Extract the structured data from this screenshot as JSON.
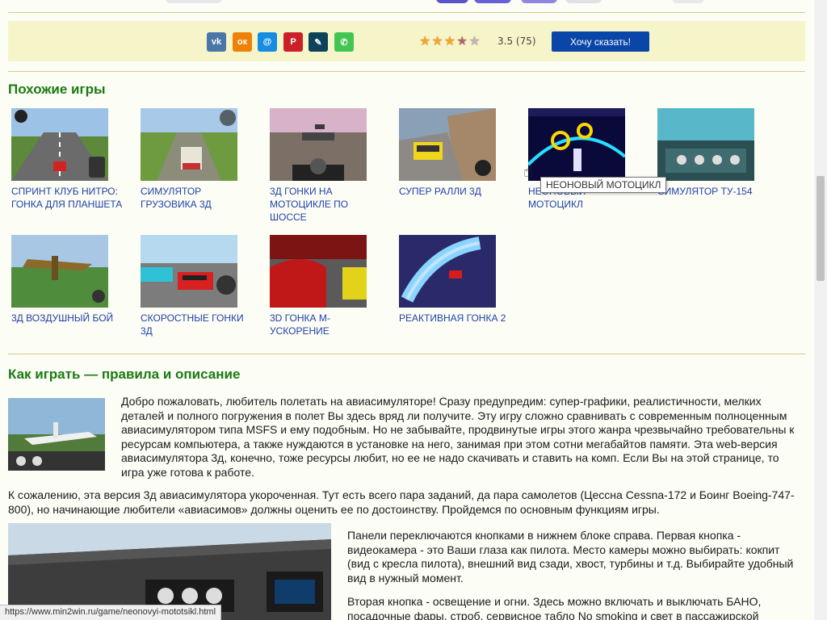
{
  "share": {
    "networks": [
      {
        "name": "vk",
        "glyph": "vk",
        "color": "#4a76a8"
      },
      {
        "name": "odnoklassniki",
        "glyph": "ок",
        "color": "#ee8208"
      },
      {
        "name": "moimir",
        "glyph": "@",
        "color": "#168de2"
      },
      {
        "name": "pinterest",
        "glyph": "P",
        "color": "#cb2027"
      },
      {
        "name": "livejournal",
        "glyph": "✎",
        "color": "#0d425a"
      },
      {
        "name": "whatsapp",
        "glyph": "✆",
        "color": "#43c553"
      }
    ],
    "rating": {
      "value": 3.5,
      "max": 5,
      "text": "3.5 (75)"
    },
    "say_button": "Хочу сказать!"
  },
  "similar": {
    "heading": "Похожие игры",
    "games": [
      {
        "title": "Спринт клуб нитро: гонка для планшета"
      },
      {
        "title": "Симулятор грузовика 3д"
      },
      {
        "title": "3д гонки на мотоцикле по шоссе"
      },
      {
        "title": "Супер ралли 3д"
      },
      {
        "title": "Неоновый мотоцикл"
      },
      {
        "title": "Симулятор ТУ-154"
      },
      {
        "title": "3д воздушный бой"
      },
      {
        "title": "Скоростные гонки 3д"
      },
      {
        "title": "3D гонка М-ускорение"
      },
      {
        "title": "Реактивная гонка 2"
      }
    ],
    "tooltip": "НЕОНОВЫЙ МОТОЦИКЛ"
  },
  "howto": {
    "heading": "Как играть — правила и описание",
    "p1": "Добро пожаловать, любитель полетать на авиасимуляторе! Сразу предупредим: супер-графики, реалистичности, мелких деталей и полного погружения в полет Вы здесь вряд ли получите. Эту игру сложно сравнивать с современным полноценным авиасимулятором типа MSFS и ему подобным. Но не забывайте, продвинутые игры этого жанра чрезвычайно требовательны к ресурсам компьютера, а также нуждаются в установке на него, занимая при этом сотни мегабайтов памяти. Эта web-версия авиасимулятора 3д, конечно, тоже ресурсы любит, но ее не надо скачивать и ставить на комп. Если Вы на этой странице, то игра уже готова к работе.",
    "p2": "К сожалению, эта версия 3д авиасимулятора укороченная. Тут есть всего пара заданий, да пара самолетов (Цессна Cessna-172 и Боинг Boeing-747-800), но начинающие любители «авиасимов» должны оценить ее по достоинству. Пройдемся по основным функциям игры.",
    "p3": "Панели переключаются кнопками в нижнем блоке справа. Первая кнопка - видеокамера - это Ваши глаза как пилота. Место камеры можно выбирать: кокпит (вид с кресла пилота), внешний вид сзади, хвост, турбины и т.д. Выбирайте удобный вид в нужный момент.",
    "p4": "Вторая кнопка - освещение и огни. Здесь можно включать и выключать БАНО, посадочные фары, строб, сервисное табло No smoking и свет в пассажирской"
  },
  "status": {
    "url": "https://www.min2win.ru/game/neonovyi-mototsikl.html"
  }
}
